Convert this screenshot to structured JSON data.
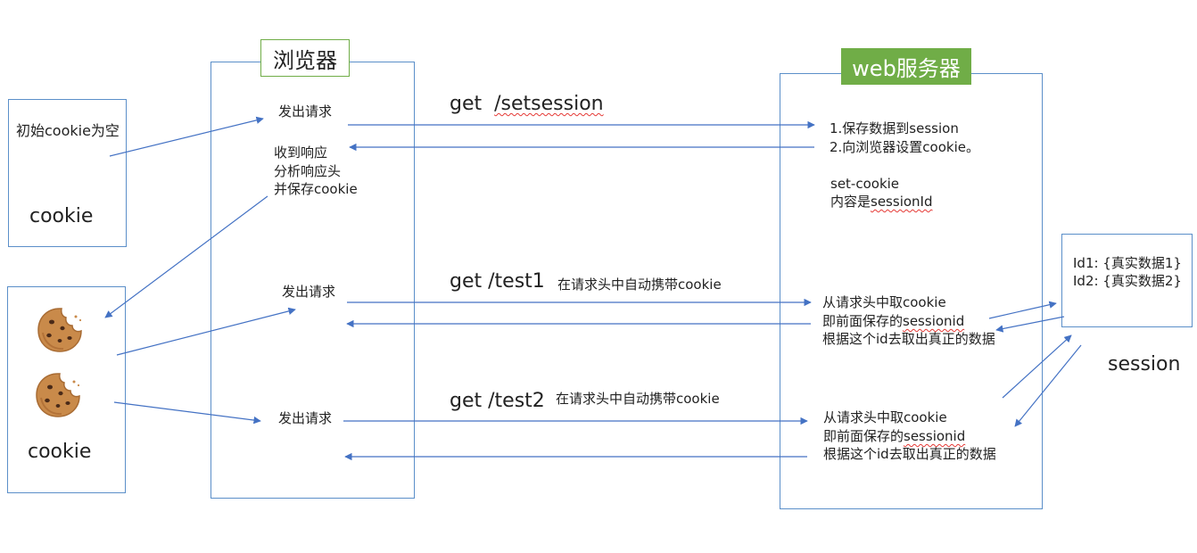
{
  "labels": {
    "browser": "浏览器",
    "server": "web服务器",
    "session": "session"
  },
  "cookie_store_1": {
    "text": "初始cookie为空",
    "label": "cookie"
  },
  "cookie_store_2": {
    "label": "cookie",
    "icons": [
      "cookie-icon",
      "cookie-icon"
    ]
  },
  "browser": {
    "req1": "发出请求",
    "resp_lines": [
      "收到响应",
      "分析响应头",
      "并保存cookie"
    ],
    "req2": "发出请求",
    "req3": "发出请求"
  },
  "requests": {
    "r1": {
      "method": "get",
      "path": "/setsession"
    },
    "r2": {
      "label": "get /test1",
      "note": "在请求头中自动携带cookie"
    },
    "r3": {
      "label": "get /test2",
      "note": "在请求头中自动携带cookie"
    }
  },
  "server": {
    "step1": [
      "1.保存数据到session",
      "2.向浏览器设置cookie。"
    ],
    "set_cookie": [
      "set-cookie",
      "内容是",
      "sessionId"
    ],
    "step2": [
      "从请求头中取cookie",
      "即前面保存的",
      "sessionid",
      "根据这个id去取出真正的数据"
    ],
    "step3": [
      "从请求头中取cookie",
      "即前面保存的",
      "sessionid",
      "根据这个id去取出真正的数据"
    ]
  },
  "session_store": {
    "lines": [
      "Id1: {真实数据1}",
      "Id2: {真实数据2}"
    ]
  },
  "colors": {
    "border": "#5b8fc9",
    "arrow": "#4472c4",
    "accent_green": "#70ad47",
    "spell_underline": "#e53935"
  }
}
